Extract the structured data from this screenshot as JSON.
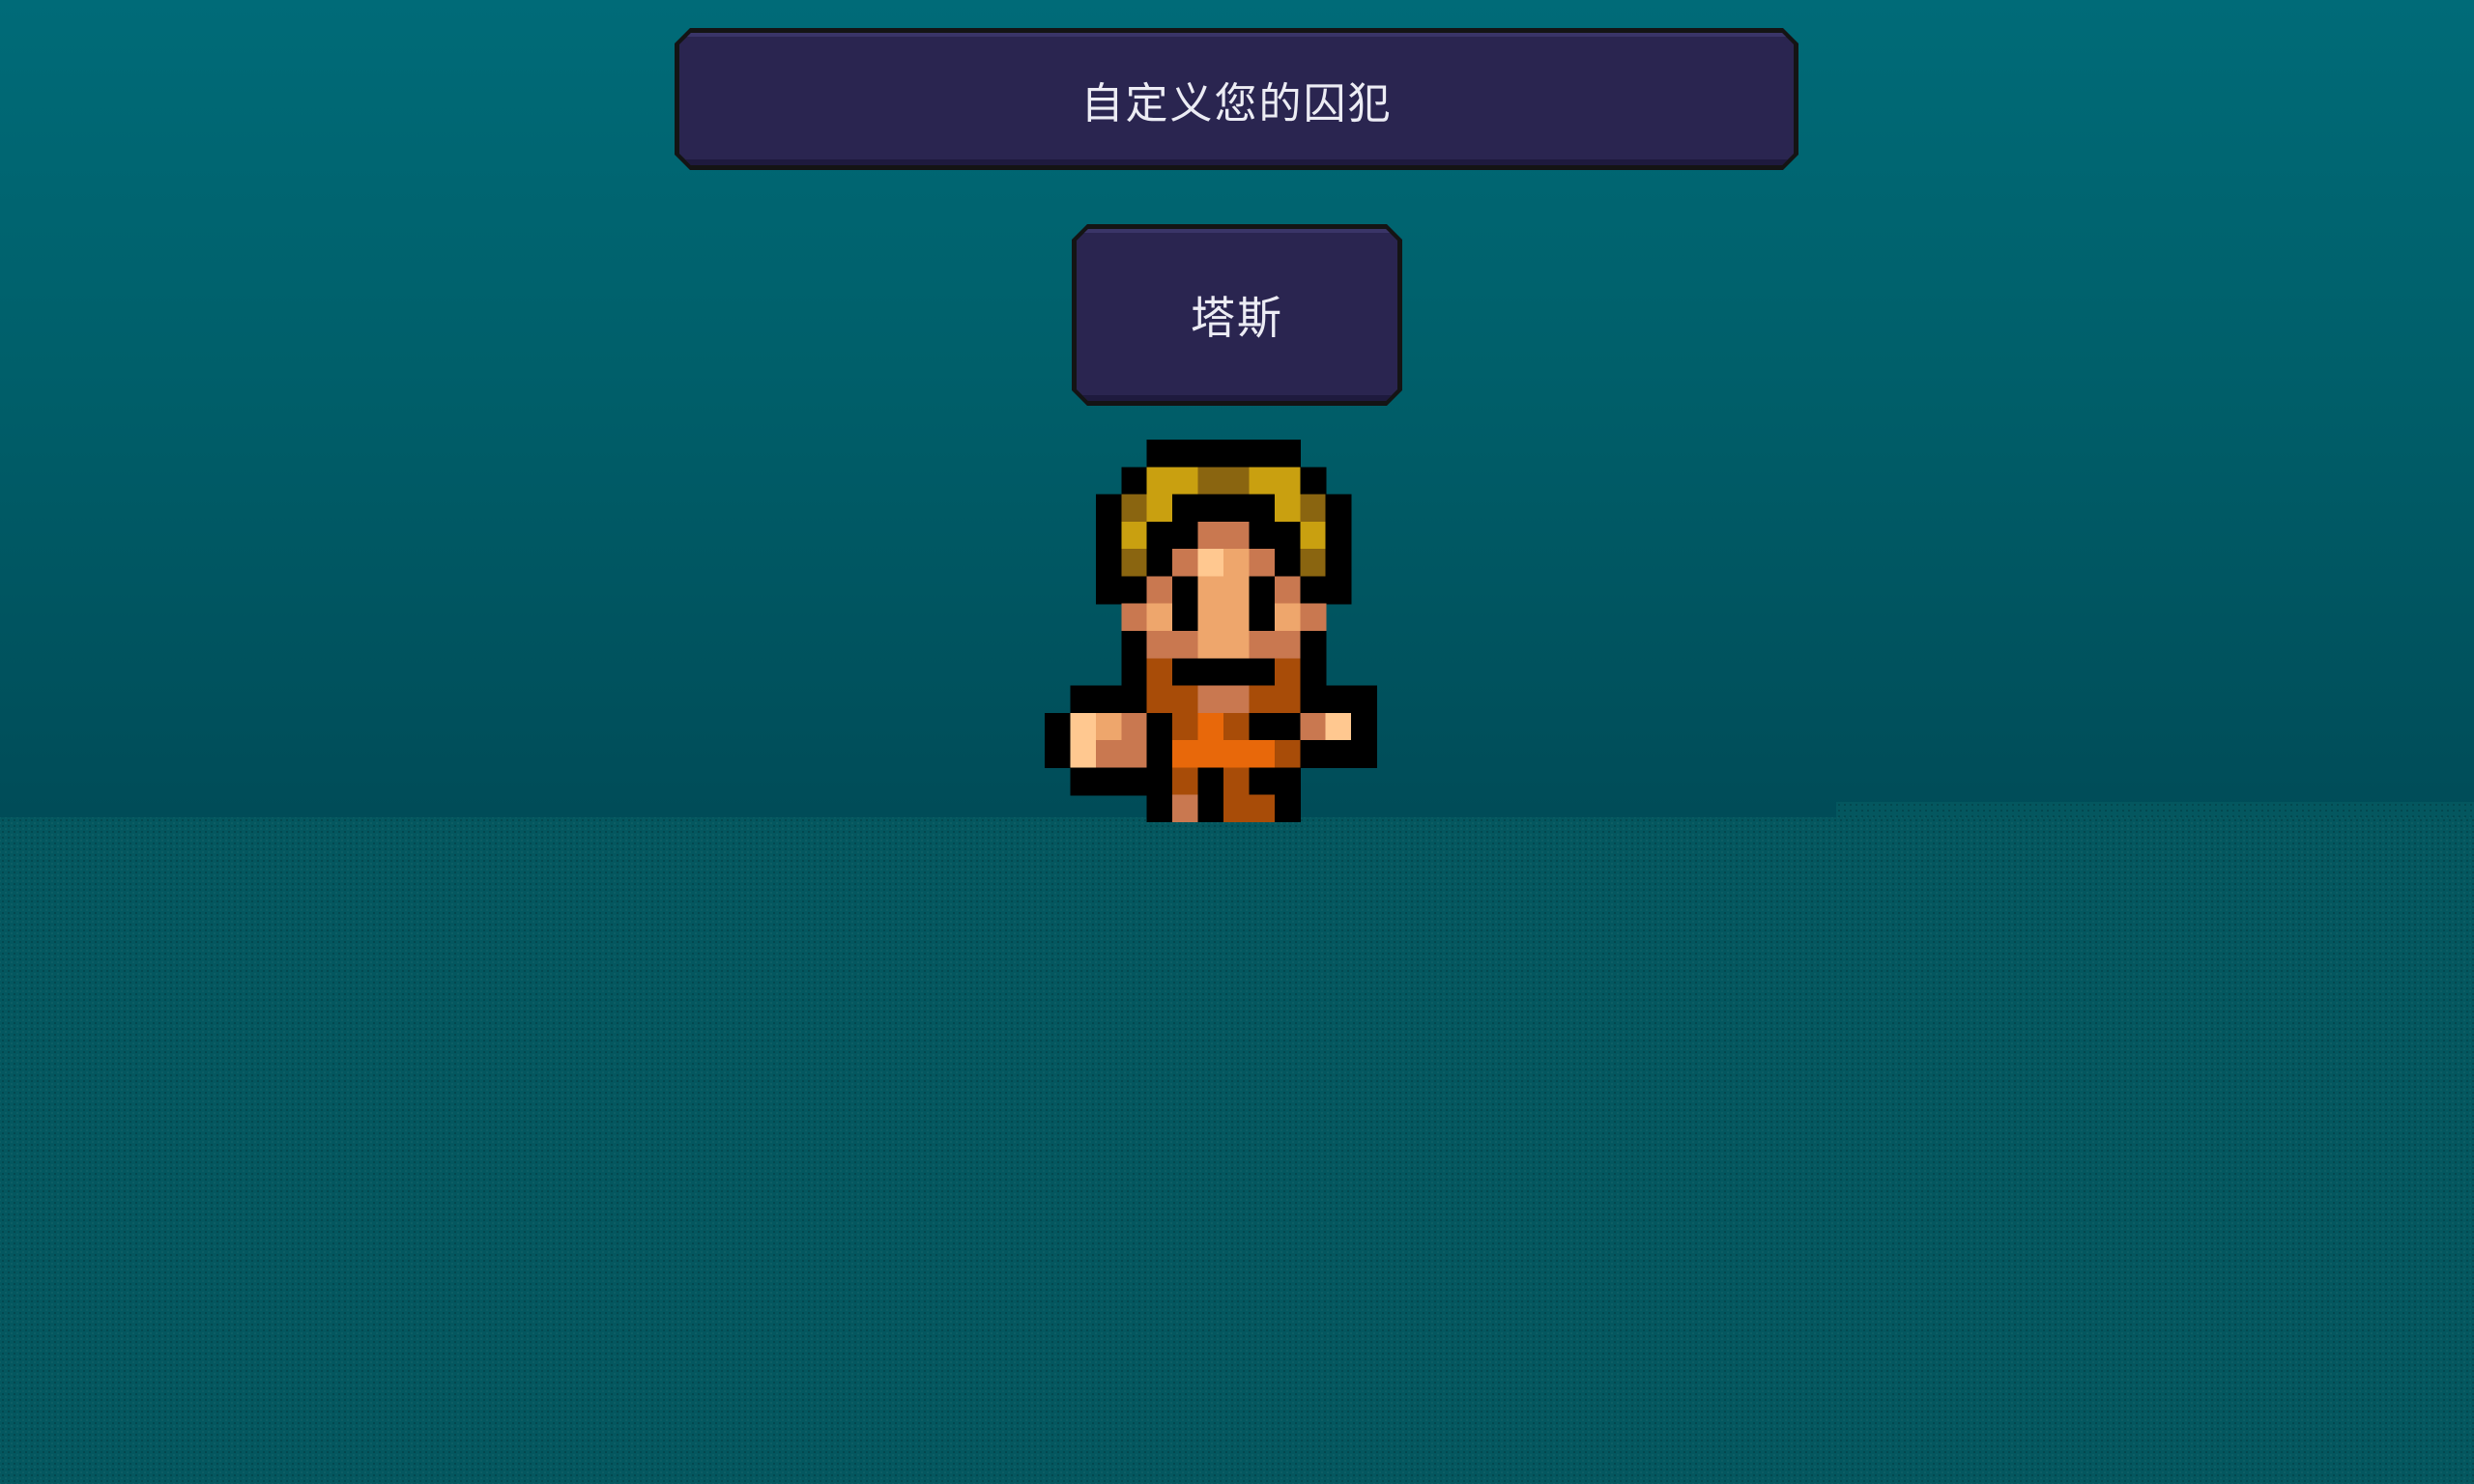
{
  "screen": {
    "title": "自定义您的囚犯",
    "prisoner_name": "塔斯"
  },
  "character": {
    "sprite": "prisoner-character",
    "colors": {
      "outline": "#000000",
      "hair_light": "#c9a010",
      "hair_dark": "#8a6510",
      "skin": "#eea66c",
      "skin_shade": "#c97850",
      "skin_highlight": "#ffc890",
      "uniform": "#e8680a",
      "uniform_shade": "#a84c08"
    }
  },
  "colors": {
    "background_top": "#006b78",
    "background_bottom": "#004c58",
    "panel_fill": "#2a2550",
    "panel_border": "#141414",
    "text": "#ececf4"
  }
}
